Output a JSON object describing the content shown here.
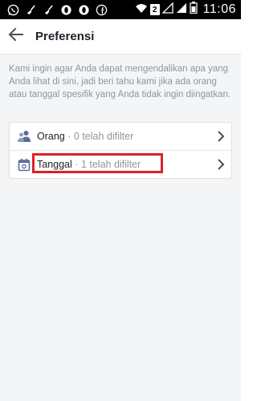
{
  "status_bar": {
    "left_icons": [
      "whatsapp-icon",
      "broom-icon",
      "broom-icon",
      "opera-icon",
      "opera-icon",
      "facebook-icon"
    ],
    "sim_slot": "2",
    "time": "11:06"
  },
  "header": {
    "title": "Preferensi"
  },
  "intro_text": "Kami ingin agar Anda dapat mengendalikan apa yang Anda lihat di sini, jadi beri tahu kami jika ada orang atau tanggal spesifik yang Anda tidak ingin diingatkan.",
  "filters": [
    {
      "icon": "people-icon",
      "label": "Orang",
      "separator": "·",
      "count_text": "0 telah difilter",
      "highlighted": false
    },
    {
      "icon": "calendar-icon",
      "label": "Tanggal",
      "separator": "·",
      "count_text": "1 telah difilter",
      "highlighted": true
    }
  ],
  "colors": {
    "highlight": "#e01f26",
    "icon_blue": "#5b6d9a",
    "muted_text": "#90949c"
  }
}
